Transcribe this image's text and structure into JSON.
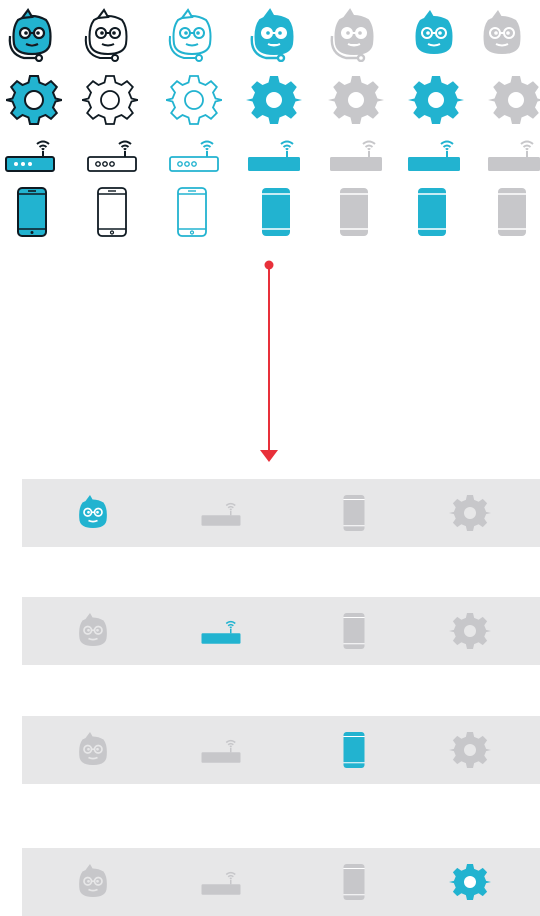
{
  "colors": {
    "accent": "#22b3d0",
    "dark": "#0f1a22",
    "grey": "#c7c7ca",
    "tabbar_bg": "#e7e7e8",
    "arrow": "#e8303a"
  },
  "icon_sheet": {
    "rows": [
      "bot-icon",
      "gear-icon",
      "router-icon",
      "phone-icon"
    ],
    "variants": [
      "filled-outlined-headset",
      "outline-dark-headset",
      "outline-accent-headset",
      "filled-accent-headset",
      "grey-headset",
      "filled-accent",
      "filled-grey"
    ]
  },
  "tab_bar_states": [
    {
      "active": "bot",
      "tabs": [
        "bot",
        "router",
        "phone",
        "gear"
      ]
    },
    {
      "active": "router",
      "tabs": [
        "bot",
        "router",
        "phone",
        "gear"
      ]
    },
    {
      "active": "phone",
      "tabs": [
        "bot",
        "router",
        "phone",
        "gear"
      ]
    },
    {
      "active": "gear",
      "tabs": [
        "bot",
        "router",
        "phone",
        "gear"
      ]
    }
  ]
}
